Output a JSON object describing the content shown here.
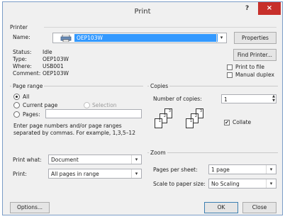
{
  "window": {
    "title": "Print",
    "help": "?",
    "close": "×"
  },
  "printer": {
    "group_label": "Printer",
    "name_label": "Name:",
    "name_value": "OEP103W",
    "properties_button": "Properties",
    "find_printer_button": "Find Printer...",
    "status_label": "Status:",
    "status_value": "Idle",
    "type_label": "Type:",
    "type_value": "OEP103W",
    "where_label": "Where:",
    "where_value": "USB001",
    "comment_label": "Comment:",
    "comment_value": "OEP103W",
    "print_to_file": "Print to file",
    "manual_duplex": "Manual duplex"
  },
  "page_range": {
    "group_label": "Page range",
    "all": "All",
    "current_page": "Current page",
    "selection": "Selection",
    "pages": "Pages:",
    "pages_value": "",
    "help_text_1": "Enter page numbers and/or page ranges",
    "help_text_2": "separated by commas.  For example, 1,3,5–12"
  },
  "copies": {
    "group_label": "Copies",
    "number_label": "Number of copies:",
    "number_value": "1",
    "collate": "Collate",
    "collate_pages_a": [
      "1",
      "2",
      "3"
    ],
    "collate_pages_b": [
      "1",
      "2",
      "3"
    ]
  },
  "print_what": {
    "label": "Print what:",
    "value": "Document"
  },
  "print": {
    "label": "Print:",
    "value": "All pages in range"
  },
  "zoom": {
    "group_label": "Zoom",
    "pages_per_sheet_label": "Pages per sheet:",
    "pages_per_sheet_value": "1 page",
    "scale_label": "Scale to paper size:",
    "scale_value": "No Scaling"
  },
  "footer": {
    "options": "Options...",
    "ok": "OK",
    "close": "Close"
  },
  "colors": {
    "accent": "#3399ff",
    "close_button": "#c7302b",
    "border": "#7a9cc7"
  }
}
